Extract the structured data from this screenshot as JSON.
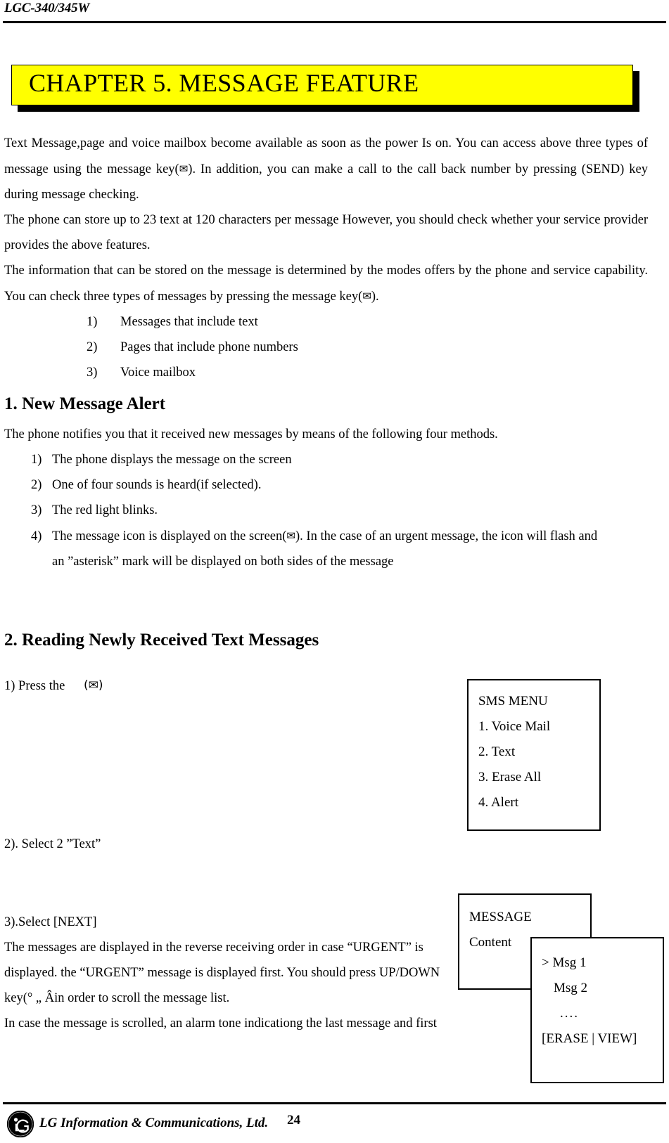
{
  "header": {
    "model": "LGC-340/345W"
  },
  "banner": {
    "title": "CHAPTER 5. MESSAGE FEATURE",
    "fill_color": "#FFFF00",
    "shadow_color": "#000000"
  },
  "intro": {
    "p1": "Text Message,page and voice mailbox become available as soon as the power Is on. You can access above three types of message using the message key(",
    "p1_icon": "✉",
    "p1_cont": "). In addition, you can make a call to the call back number by pressing (SEND) key during message checking.",
    "p2": "The phone can store up to 23 text at 120 characters per message However, you should check whether your service provider provides the above features.",
    "p3": "The information that can be stored on the message is determined by the modes offers by the phone and service capability. You can check three types of messages by pressing the message key(",
    "p3_icon": "✉",
    "p3_cont": ").",
    "list": [
      {
        "num": "1)",
        "text": "Messages that include text"
      },
      {
        "num": "2)",
        "text": "Pages that include phone numbers"
      },
      {
        "num": "3)",
        "text": "Voice mailbox"
      }
    ]
  },
  "section1": {
    "heading": "1. New Message Alert",
    "intro": "The phone notifies you that it received new messages by means of the following four methods.",
    "list": [
      {
        "num": "1)",
        "text": "The phone displays the message on the screen"
      },
      {
        "num": "2)",
        "text": "One of four sounds is heard(if selected)."
      },
      {
        "num": "3)",
        "text": "The red light blinks."
      },
      {
        "num": "4)",
        "text": "The message icon is displayed on the screen(",
        "icon": "✉",
        "text2": "). In the case of an urgent message, the icon will flash and",
        "text3": "an ”asterisk” mark will be displayed on both sides of the message"
      }
    ]
  },
  "section2": {
    "heading": "2. Reading Newly Received Text Messages",
    "step1": "1) Press the",
    "step1_icon": "(✉)",
    "step2": "2). Select 2 ”Text”",
    "step3": "3).Select [NEXT]",
    "body1": "  The messages are displayed in the reverse receiving order in case “URGENT” is",
    "body2": "displayed. the “URGENT” message is displayed first. You should press UP/DOWN",
    "body3": "key(° „ Âin order to scroll the message list.",
    "body4": "In case the message is scrolled, an alarm tone indicationg the last message and first"
  },
  "sms_menu_box": {
    "title": "SMS MENU",
    "items": [
      "1. Voice Mail",
      "2. Text",
      "3. Erase All",
      "4. Alert"
    ]
  },
  "message_box": {
    "title": "MESSAGE",
    "line2": "Content"
  },
  "msg_list_box": {
    "line1": "> Msg 1",
    "line2": "Msg 2",
    "line3": "....",
    "line4": "[ERASE | VIEW]"
  },
  "footer": {
    "company": "LG Information & Communications, Ltd.",
    "page_number": "24"
  }
}
